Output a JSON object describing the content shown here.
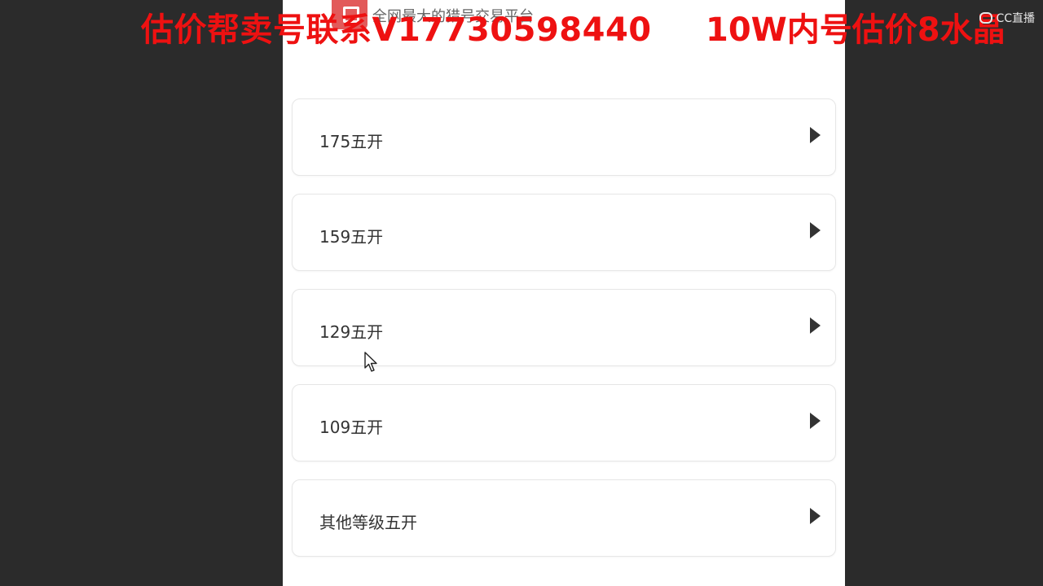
{
  "header": {
    "subtitle": "全网最大的猎号交易平台"
  },
  "list": {
    "items": [
      {
        "label": "175五开"
      },
      {
        "label": "159五开"
      },
      {
        "label": "129五开"
      },
      {
        "label": "109五开"
      },
      {
        "label": "其他等级五开"
      }
    ]
  },
  "overlay": {
    "left_text": "估价帮卖号联系V17730598440",
    "right_text": "10W内号估价8水晶"
  },
  "watermark": {
    "brand": "CC直播",
    "icon": "cc-logo-icon"
  },
  "colors": {
    "overlay_red": "#ee1111",
    "card_border": "#e6e6e6",
    "arrow": "#333333",
    "logo": "#e25a5a"
  }
}
